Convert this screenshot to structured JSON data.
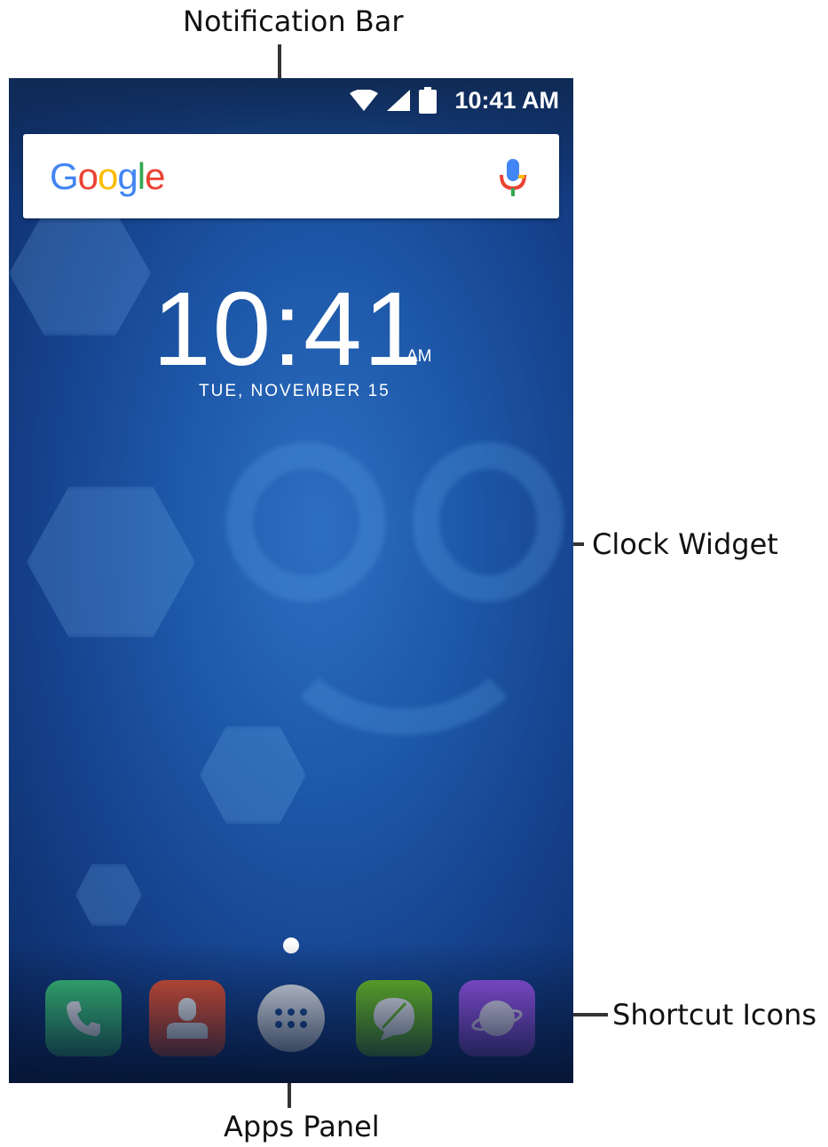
{
  "callouts": {
    "notification_bar": "Notification Bar",
    "clock_widget": "Clock Widget",
    "shortcut_icons": "Shortcut Icons",
    "apps_panel": "Apps Panel"
  },
  "status_bar": {
    "time": "10:41 AM",
    "icons": [
      "wifi-icon",
      "cell-signal-icon",
      "battery-icon"
    ]
  },
  "search_widget": {
    "logo_text": "Google",
    "mic_icon": "mic-icon",
    "logo_colors": [
      "#4285F4",
      "#EA4335",
      "#FBBC05",
      "#4285F4",
      "#34A853",
      "#EA4335"
    ]
  },
  "clock_widget": {
    "time": "10:41",
    "ampm": "AM",
    "date": "TUE, NOVEMBER 15"
  },
  "dock": {
    "icons": [
      {
        "name": "phone-icon",
        "color": "#3fcf7d"
      },
      {
        "name": "contacts-icon",
        "color": "#ee5532"
      },
      {
        "name": "apps-panel-icon",
        "color": "#eef2f7"
      },
      {
        "name": "messages-icon",
        "color": "#72cc24"
      },
      {
        "name": "browser-icon",
        "color": "#9f58f3"
      }
    ]
  }
}
